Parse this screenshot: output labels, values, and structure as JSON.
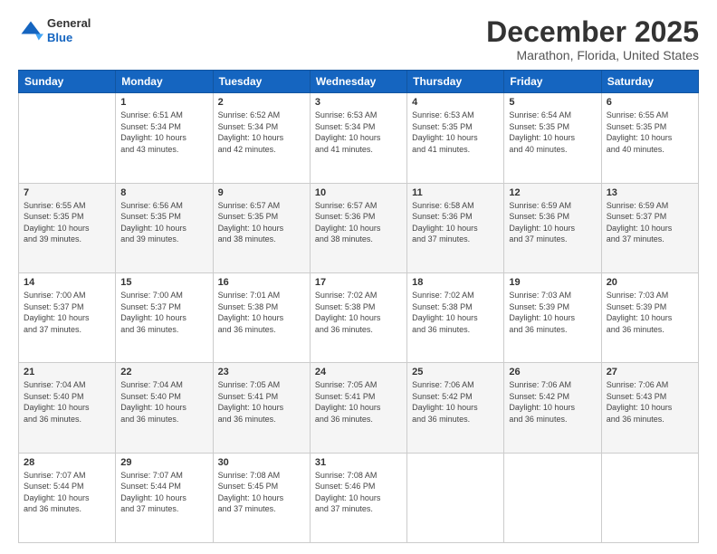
{
  "logo": {
    "line1": "General",
    "line2": "Blue"
  },
  "title": "December 2025",
  "subtitle": "Marathon, Florida, United States",
  "headers": [
    "Sunday",
    "Monday",
    "Tuesday",
    "Wednesday",
    "Thursday",
    "Friday",
    "Saturday"
  ],
  "weeks": [
    [
      {
        "day": "",
        "info": ""
      },
      {
        "day": "1",
        "info": "Sunrise: 6:51 AM\nSunset: 5:34 PM\nDaylight: 10 hours\nand 43 minutes."
      },
      {
        "day": "2",
        "info": "Sunrise: 6:52 AM\nSunset: 5:34 PM\nDaylight: 10 hours\nand 42 minutes."
      },
      {
        "day": "3",
        "info": "Sunrise: 6:53 AM\nSunset: 5:34 PM\nDaylight: 10 hours\nand 41 minutes."
      },
      {
        "day": "4",
        "info": "Sunrise: 6:53 AM\nSunset: 5:35 PM\nDaylight: 10 hours\nand 41 minutes."
      },
      {
        "day": "5",
        "info": "Sunrise: 6:54 AM\nSunset: 5:35 PM\nDaylight: 10 hours\nand 40 minutes."
      },
      {
        "day": "6",
        "info": "Sunrise: 6:55 AM\nSunset: 5:35 PM\nDaylight: 10 hours\nand 40 minutes."
      }
    ],
    [
      {
        "day": "7",
        "info": "Sunrise: 6:55 AM\nSunset: 5:35 PM\nDaylight: 10 hours\nand 39 minutes."
      },
      {
        "day": "8",
        "info": "Sunrise: 6:56 AM\nSunset: 5:35 PM\nDaylight: 10 hours\nand 39 minutes."
      },
      {
        "day": "9",
        "info": "Sunrise: 6:57 AM\nSunset: 5:35 PM\nDaylight: 10 hours\nand 38 minutes."
      },
      {
        "day": "10",
        "info": "Sunrise: 6:57 AM\nSunset: 5:36 PM\nDaylight: 10 hours\nand 38 minutes."
      },
      {
        "day": "11",
        "info": "Sunrise: 6:58 AM\nSunset: 5:36 PM\nDaylight: 10 hours\nand 37 minutes."
      },
      {
        "day": "12",
        "info": "Sunrise: 6:59 AM\nSunset: 5:36 PM\nDaylight: 10 hours\nand 37 minutes."
      },
      {
        "day": "13",
        "info": "Sunrise: 6:59 AM\nSunset: 5:37 PM\nDaylight: 10 hours\nand 37 minutes."
      }
    ],
    [
      {
        "day": "14",
        "info": "Sunrise: 7:00 AM\nSunset: 5:37 PM\nDaylight: 10 hours\nand 37 minutes."
      },
      {
        "day": "15",
        "info": "Sunrise: 7:00 AM\nSunset: 5:37 PM\nDaylight: 10 hours\nand 36 minutes."
      },
      {
        "day": "16",
        "info": "Sunrise: 7:01 AM\nSunset: 5:38 PM\nDaylight: 10 hours\nand 36 minutes."
      },
      {
        "day": "17",
        "info": "Sunrise: 7:02 AM\nSunset: 5:38 PM\nDaylight: 10 hours\nand 36 minutes."
      },
      {
        "day": "18",
        "info": "Sunrise: 7:02 AM\nSunset: 5:38 PM\nDaylight: 10 hours\nand 36 minutes."
      },
      {
        "day": "19",
        "info": "Sunrise: 7:03 AM\nSunset: 5:39 PM\nDaylight: 10 hours\nand 36 minutes."
      },
      {
        "day": "20",
        "info": "Sunrise: 7:03 AM\nSunset: 5:39 PM\nDaylight: 10 hours\nand 36 minutes."
      }
    ],
    [
      {
        "day": "21",
        "info": "Sunrise: 7:04 AM\nSunset: 5:40 PM\nDaylight: 10 hours\nand 36 minutes."
      },
      {
        "day": "22",
        "info": "Sunrise: 7:04 AM\nSunset: 5:40 PM\nDaylight: 10 hours\nand 36 minutes."
      },
      {
        "day": "23",
        "info": "Sunrise: 7:05 AM\nSunset: 5:41 PM\nDaylight: 10 hours\nand 36 minutes."
      },
      {
        "day": "24",
        "info": "Sunrise: 7:05 AM\nSunset: 5:41 PM\nDaylight: 10 hours\nand 36 minutes."
      },
      {
        "day": "25",
        "info": "Sunrise: 7:06 AM\nSunset: 5:42 PM\nDaylight: 10 hours\nand 36 minutes."
      },
      {
        "day": "26",
        "info": "Sunrise: 7:06 AM\nSunset: 5:42 PM\nDaylight: 10 hours\nand 36 minutes."
      },
      {
        "day": "27",
        "info": "Sunrise: 7:06 AM\nSunset: 5:43 PM\nDaylight: 10 hours\nand 36 minutes."
      }
    ],
    [
      {
        "day": "28",
        "info": "Sunrise: 7:07 AM\nSunset: 5:44 PM\nDaylight: 10 hours\nand 36 minutes."
      },
      {
        "day": "29",
        "info": "Sunrise: 7:07 AM\nSunset: 5:44 PM\nDaylight: 10 hours\nand 37 minutes."
      },
      {
        "day": "30",
        "info": "Sunrise: 7:08 AM\nSunset: 5:45 PM\nDaylight: 10 hours\nand 37 minutes."
      },
      {
        "day": "31",
        "info": "Sunrise: 7:08 AM\nSunset: 5:46 PM\nDaylight: 10 hours\nand 37 minutes."
      },
      {
        "day": "",
        "info": ""
      },
      {
        "day": "",
        "info": ""
      },
      {
        "day": "",
        "info": ""
      }
    ]
  ]
}
